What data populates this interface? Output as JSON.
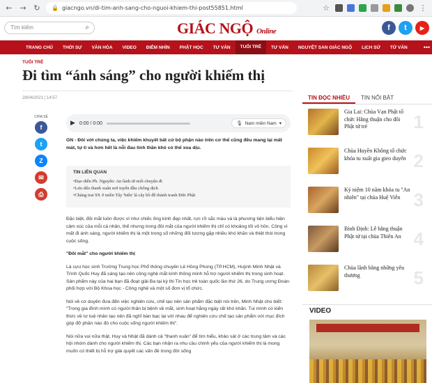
{
  "browser": {
    "url": "giacngo.vn/di-tim-anh-sang-cho-nguoi-khiem-thi-post55851.html"
  },
  "header": {
    "search_placeholder": "Tìm kiếm",
    "logo_main": "GIÁC NGỘ",
    "logo_sub": "Online",
    "social": [
      "f",
      "t",
      "▶"
    ]
  },
  "nav": {
    "items": [
      "TRANG CHỦ",
      "THỜI SỰ",
      "VĂN HÓA",
      "VIDEO",
      "ĐIỂM NHÌN",
      "PHẬT HỌC",
      "TƯ VẤN",
      "TUỔI TRẺ",
      "TƯ VẤN",
      "NGUYỆT SAN GIÁC NGỘ",
      "LỊCH SỬ",
      "TỬ VĂN"
    ],
    "more": "•••"
  },
  "article": {
    "category": "TUỔI TRẺ",
    "title": "Đi tìm “ánh sáng” cho người khiếm thị",
    "date": "28/04/2021 | 14:57",
    "share_label": "CHIA SẺ",
    "audio": {
      "time": "0:00 / 0:00",
      "voice": "Nam miền Nam"
    },
    "lead": "GN - Đôi với chúng ta, việc khiếm khuyết bất cứ bộ phận nào trên cơ thể cũng đều mang lại mất mát, tự ti và hơn hết là nỗi đau tinh thần khó có thể xoa dịu.",
    "related": {
      "heading": "TIN LIÊN QUAN",
      "items": [
        "Đạo diễn Ph. Nguyễn: An lành từ mối chuyện đi",
        "Lưu dấu thanh xuân nơi tuyến đầu chống dịch",
        "Chàng trai 9X ở miền Tây 'biến' lá cây bồ đề thành tranh Đức Phật"
      ]
    },
    "paragraphs": [
      "Đặc biệt, đôi mắt luôn được ví như chiếc ống kính đẹp nhất, rực rỡ sắc màu và là phương tiện biểu hiện cảm xúc của mỗi cá nhân, thế nhưng trong đôi mắt của người khiếm thị chỉ có khoảng tối vô hồn. Công vì mất đi ánh sáng, người khiếm thị là một trong số những đối tượng gặp nhiều khó khăn và thiệt thòi trong cuộc sống.",
      "\"Đôi mắt\" cho người khiếm thị",
      "Là cựu học sinh Trường Trung học Phổ thông chuyên Lê Hồng Phong (TP.HCM), Huỳnh Minh Nhật và Trình Quốc Huy đã sáng tạo nên công nghệ mắt kính thông minh hỗ trợ người khiếm thị trong sinh hoạt. Sản phẩm này của hai bạn đã đoạt giải Ba tại kỳ thi Tin học trẻ toàn quốc lần thứ 26, do Trung ương Đoàn phối hợp với Bộ Khoa học - Công nghệ và một số đơn vị tổ chức.",
      "Nói về cơ duyên đưa đến việc nghiên cứu, chế tạo nên sản phẩm đặc biệt nói trên, Minh Nhật cho biết: \"Trong gia đình mình có người thân bị bệnh về mắt, sinh hoạt hằng ngày rất khó khăn. Tui mình có kiến thức về tư tuệ nhân tạo nên đã nghĩ bàn bạc lại với nhau để nghiên cứu chế tạo sản phẩm với mục đích góp đỡ phần nào đó cho cuộc sống người khiếm thị\".",
      "Nói nữa vui nữa thật, Huy và Nhật đã dành cả \"thanh xuân\" để tìm hiểu, khảo sát ở các trung tâm và các hội nhóm dành cho người khiếm thị. Các bạn nhận ra nhu cầu chính yếu của người khiếm thị là mong muốn có thiết bị hỗ trợ giải quyết các vấn đề trong đời sống"
    ]
  },
  "sidebar": {
    "tabs": [
      "TIN ĐỌC NHIỀU",
      "TIN NỔI BẬT"
    ],
    "news": [
      {
        "title": "Gia Lai: Chùa Vạn Phật tổ chức Hằng thuận cho đôi Phật tử trẻ",
        "num": "1"
      },
      {
        "title": "Chùa Huyền Không tổ chức khóa tu xuất gia gieo duyên",
        "num": "2"
      },
      {
        "title": "Kỷ niệm 10 năm khóa tu \"An nhiên\" tại chùa Huệ Viễn",
        "num": "3"
      },
      {
        "title": "Bình Định: Lễ hằng thuận Phật tử tại chùa Thiên An",
        "num": "4"
      },
      {
        "title": "Chùa lãnh bằng những yêu thương",
        "num": "5"
      }
    ],
    "video_heading": "VIDEO"
  },
  "colors": {
    "brand_red": "#b5121b",
    "facebook": "#3b5998",
    "twitter": "#1da1f2",
    "youtube": "#e62117"
  }
}
